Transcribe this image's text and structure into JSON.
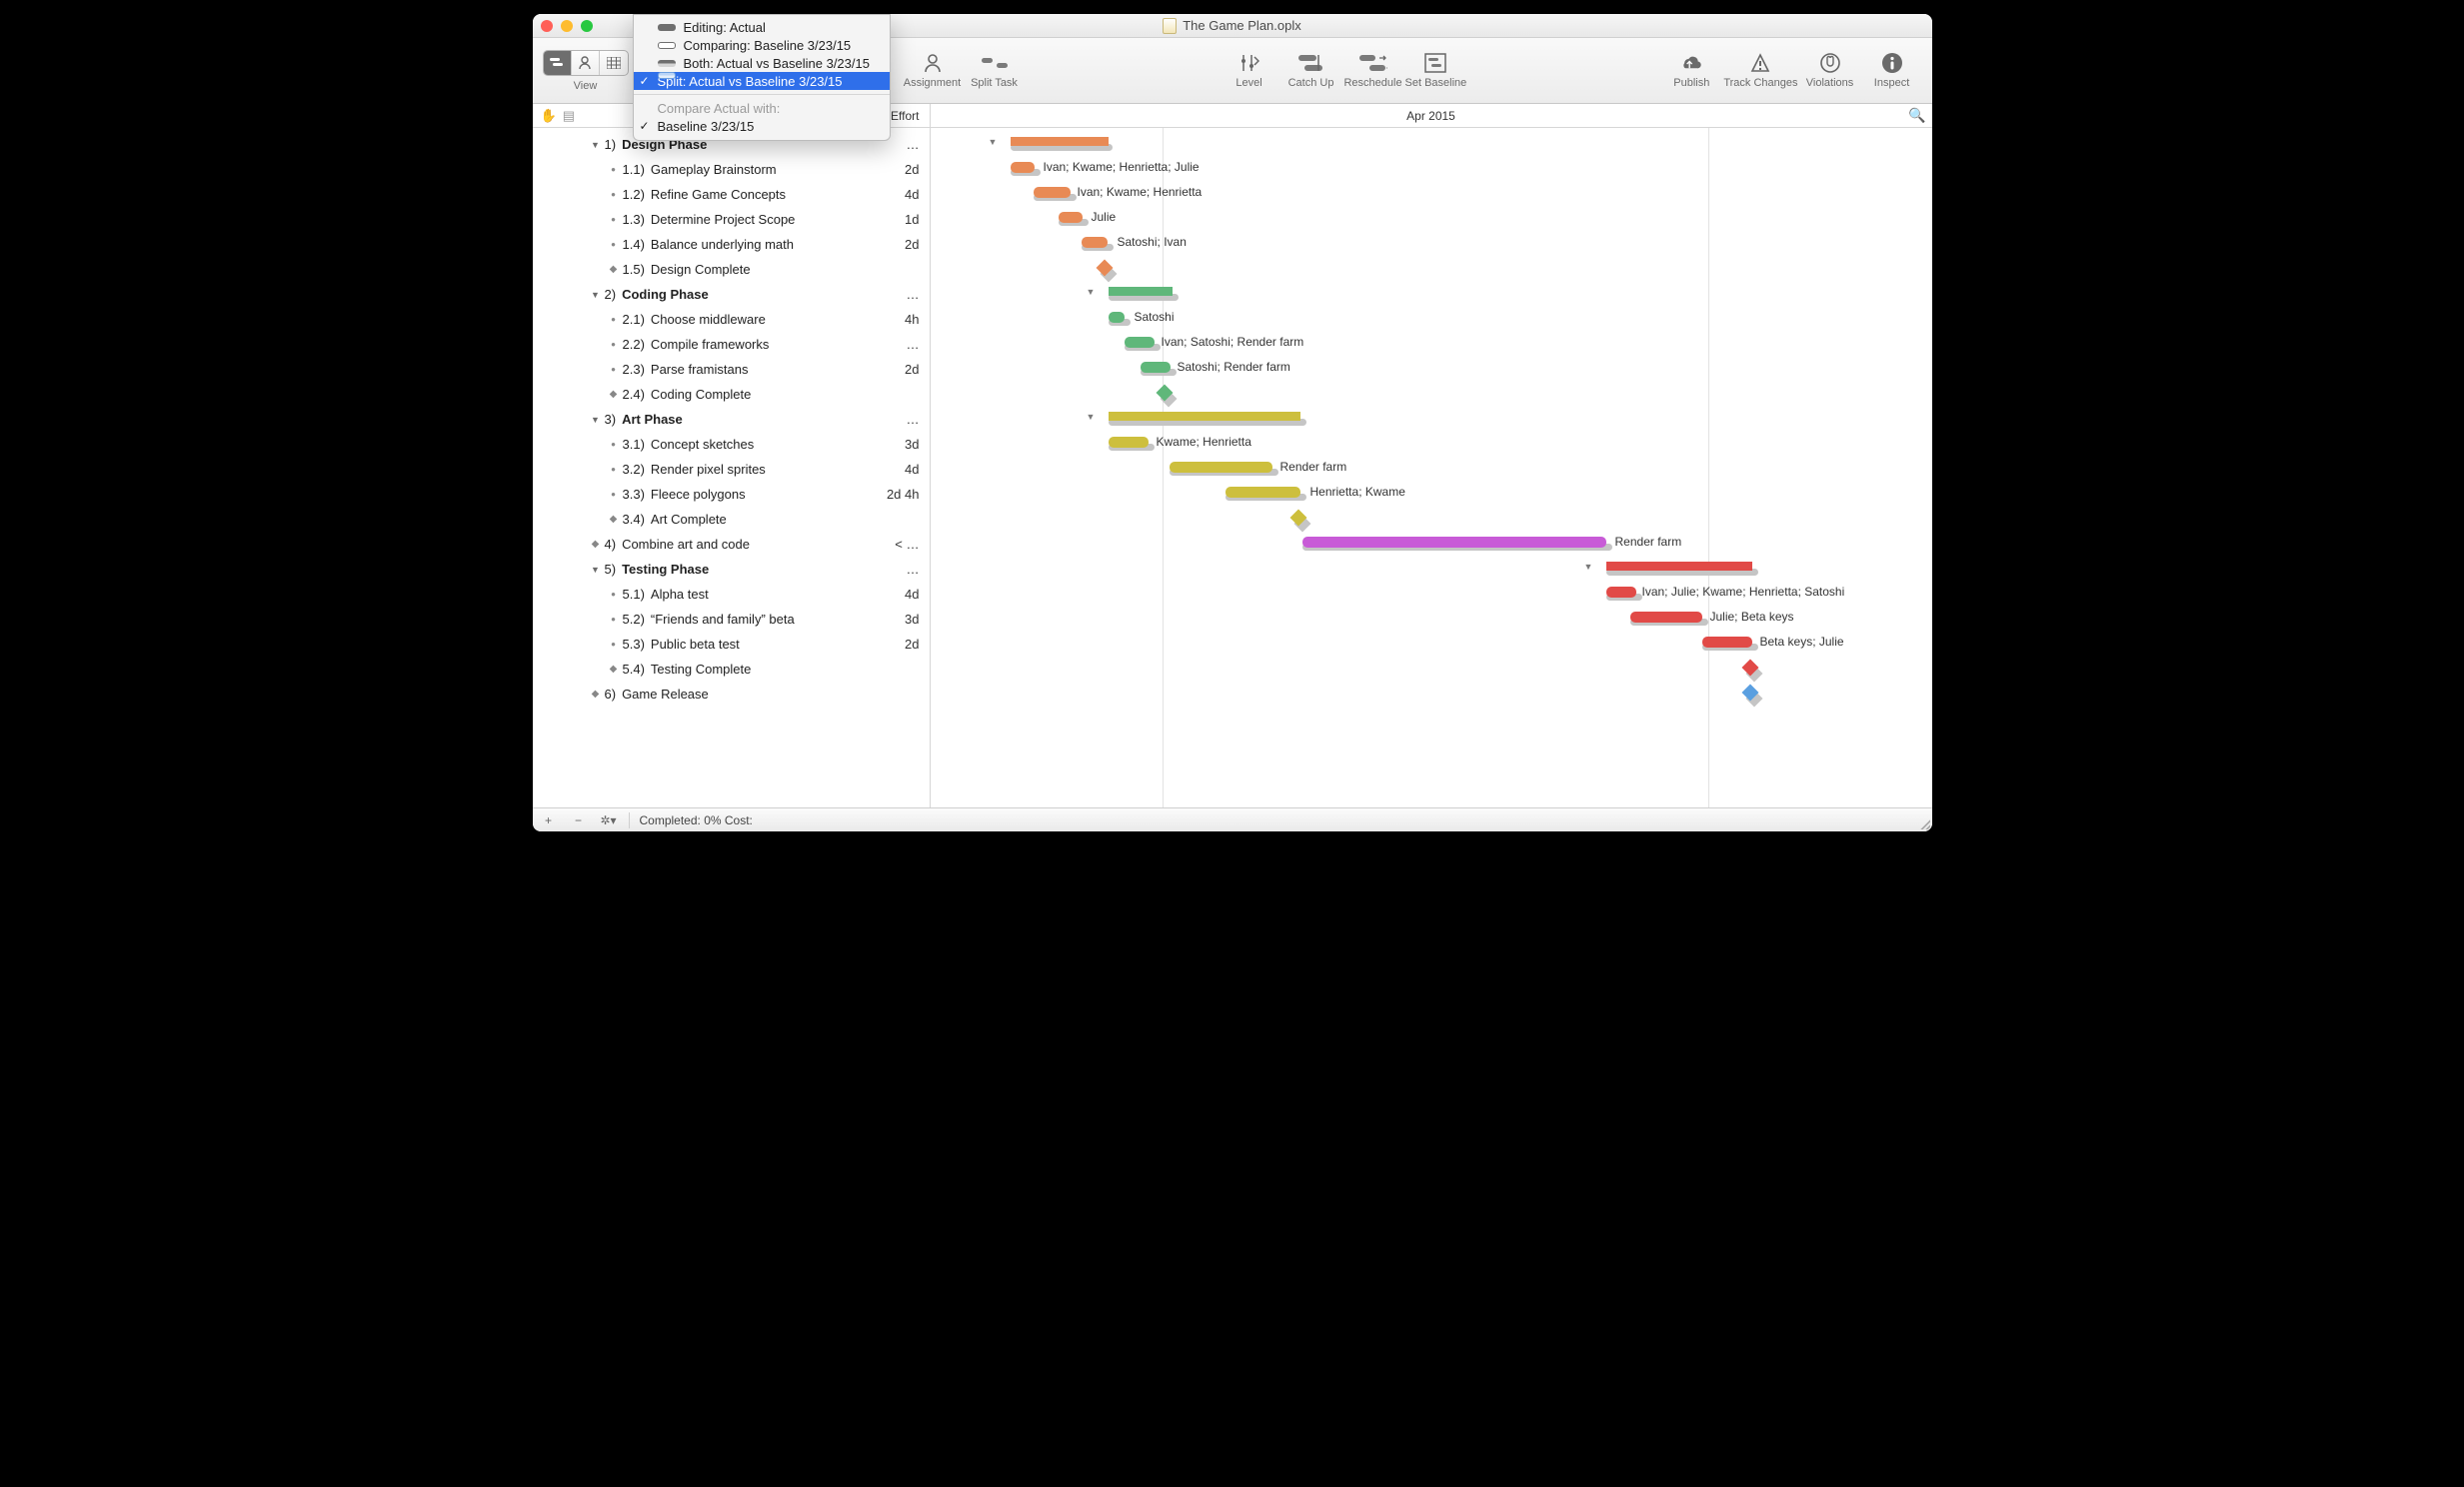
{
  "window": {
    "title": "The Game Plan.oplx"
  },
  "toolbar": {
    "view_label": "View",
    "assignment": "Assignment",
    "split_task": "Split Task",
    "level": "Level",
    "catch_up": "Catch Up",
    "reschedule": "Reschedule",
    "set_baseline": "Set Baseline",
    "publish": "Publish",
    "track_changes": "Track Changes",
    "violations": "Violations",
    "inspect": "Inspect"
  },
  "menu": {
    "editing": "Editing: Actual",
    "comparing": "Comparing: Baseline 3/23/15",
    "both": "Both: Actual vs Baseline 3/23/15",
    "split": "Split: Actual vs Baseline 3/23/15",
    "compare_hdr": "Compare Actual with:",
    "baseline_item": "Baseline 3/23/15"
  },
  "header": {
    "effort": "Effort",
    "month": "Apr 2015"
  },
  "outline": [
    {
      "lvl": 1,
      "ico": "tri",
      "num": "1)",
      "t": "Design Phase",
      "eff": "…",
      "bold": true
    },
    {
      "lvl": 2,
      "ico": "dot",
      "num": "1.1)",
      "t": "Gameplay Brainstorm",
      "eff": "2d"
    },
    {
      "lvl": 2,
      "ico": "dot",
      "num": "1.2)",
      "t": "Refine Game Concepts",
      "eff": "4d"
    },
    {
      "lvl": 2,
      "ico": "dot",
      "num": "1.3)",
      "t": "Determine Project Scope",
      "eff": "1d"
    },
    {
      "lvl": 2,
      "ico": "dot",
      "num": "1.4)",
      "t": "Balance underlying math",
      "eff": "2d"
    },
    {
      "lvl": 2,
      "ico": "dia",
      "num": "1.5)",
      "t": "Design Complete",
      "eff": ""
    },
    {
      "lvl": 1,
      "ico": "tri",
      "num": "2)",
      "t": "Coding Phase",
      "eff": "…",
      "bold": true
    },
    {
      "lvl": 2,
      "ico": "dot",
      "num": "2.1)",
      "t": "Choose middleware",
      "eff": "4h"
    },
    {
      "lvl": 2,
      "ico": "dot",
      "num": "2.2)",
      "t": "Compile frameworks",
      "eff": "…"
    },
    {
      "lvl": 2,
      "ico": "dot",
      "num": "2.3)",
      "t": "Parse framistans",
      "eff": "2d"
    },
    {
      "lvl": 2,
      "ico": "dia",
      "num": "2.4)",
      "t": "Coding Complete",
      "eff": ""
    },
    {
      "lvl": 1,
      "ico": "tri",
      "num": "3)",
      "t": "Art Phase",
      "eff": "…",
      "bold": true
    },
    {
      "lvl": 2,
      "ico": "dot",
      "num": "3.1)",
      "t": "Concept sketches",
      "eff": "3d"
    },
    {
      "lvl": 2,
      "ico": "dot",
      "num": "3.2)",
      "t": "Render pixel sprites",
      "eff": "4d"
    },
    {
      "lvl": 2,
      "ico": "dot",
      "num": "3.3)",
      "t": "Fleece polygons",
      "eff": "2d 4h"
    },
    {
      "lvl": 2,
      "ico": "dia",
      "num": "3.4)",
      "t": "Art Complete",
      "eff": ""
    },
    {
      "lvl": 1,
      "ico": "dia",
      "num": "4)",
      "t": "Combine art and code",
      "eff": "< …"
    },
    {
      "lvl": 1,
      "ico": "tri",
      "num": "5)",
      "t": "Testing Phase",
      "eff": "…",
      "bold": true
    },
    {
      "lvl": 2,
      "ico": "dot",
      "num": "5.1)",
      "t": "Alpha test",
      "eff": "4d"
    },
    {
      "lvl": 2,
      "ico": "dot",
      "num": "5.2)",
      "t": "“Friends and family” beta",
      "eff": "3d"
    },
    {
      "lvl": 2,
      "ico": "dot",
      "num": "5.3)",
      "t": "Public beta test",
      "eff": "2d"
    },
    {
      "lvl": 2,
      "ico": "dia",
      "num": "5.4)",
      "t": "Testing Complete",
      "eff": ""
    },
    {
      "lvl": 1,
      "ico": "dia",
      "num": "6)",
      "t": "Game Release",
      "eff": ""
    }
  ],
  "gantt_labels": {
    "r1": "Ivan; Kwame; Henrietta; Julie",
    "r2": "Ivan; Kwame; Henrietta",
    "r3": "Julie",
    "r4": "Satoshi; Ivan",
    "r7": "Satoshi",
    "r8": "Ivan; Satoshi; Render farm",
    "r9": "Satoshi; Render farm",
    "r12": "Kwame; Henrietta",
    "r13": "Render farm",
    "r14": "Henrietta; Kwame",
    "r16": "Render farm",
    "r18": "Ivan; Julie; Kwame; Henrietta; Satoshi",
    "r19": "Julie; Beta keys",
    "r20": "Beta keys; Julie"
  },
  "footer": {
    "completed": "Completed: 0% Cost:"
  }
}
